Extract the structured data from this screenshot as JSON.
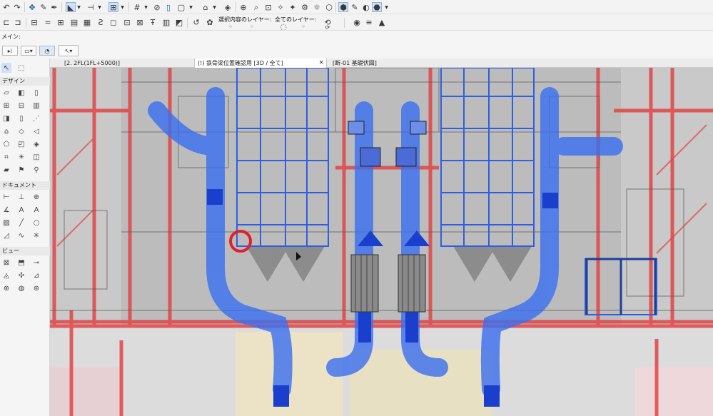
{
  "toolbar": {
    "layer_selection_label": "選択内容のレイヤー:",
    "layer_all_label": "全てのレイヤー:"
  },
  "infobox": {
    "main_label": "メイン:"
  },
  "toolbox": {
    "section_design": "デザイン",
    "section_document": "ドキュメント",
    "section_view": "ビュー"
  },
  "tabs": [
    {
      "label": "[2. 2FL(1FL+5000)]"
    },
    {
      "label": "(!) 鉄骨梁位置確認用 [3D / 全て]"
    },
    {
      "label": "[断-01 基礎伏図]"
    }
  ],
  "icons": [
    "undo-icon",
    "redo-icon",
    "pointer-icon",
    "eyedropper-icon",
    "layer-icon",
    "grid-icon",
    "lock-icon",
    "view-icon",
    "close-icon"
  ],
  "colors": {
    "accent": "#1f5fbf",
    "steel_red": "#e14545",
    "duct_blue": "#3a6ff0"
  }
}
